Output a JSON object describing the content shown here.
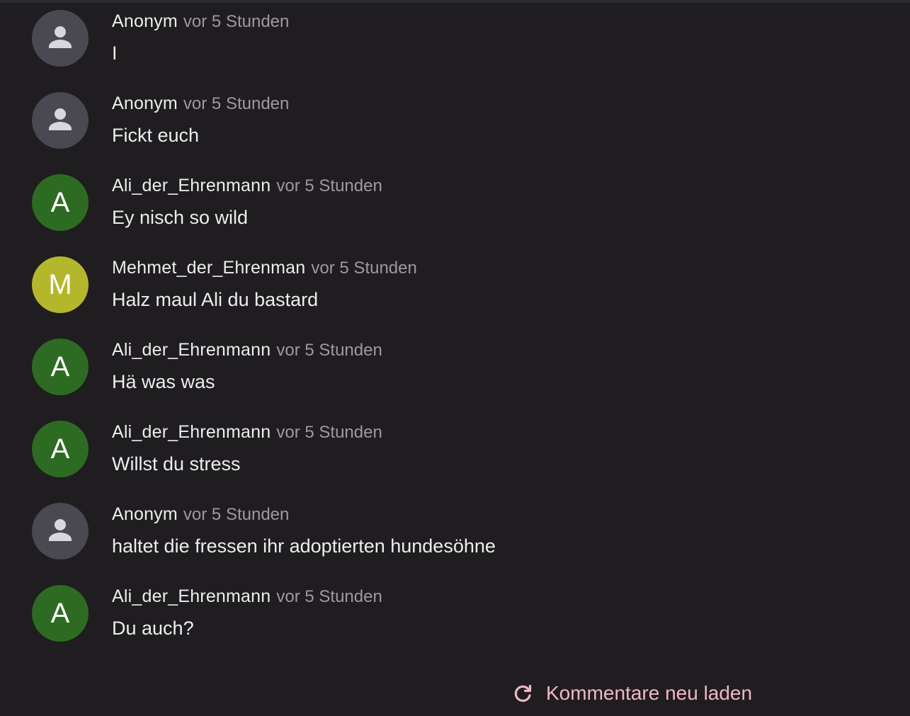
{
  "colors": {
    "background": "#1f1d20",
    "anonymous_avatar": "#4a4850",
    "green_avatar": "#2e6b22",
    "yellow_avatar": "#b4b72c",
    "accent": "#f2b6c8",
    "time_text": "#9c9aa0"
  },
  "comments": [
    {
      "author": "Anonym",
      "time": "vor 5 Stunden",
      "text": "I",
      "avatar_letter": "",
      "avatar_icon": "person-icon",
      "avatar_color": "#4a4850"
    },
    {
      "author": "Anonym",
      "time": "vor 5 Stunden",
      "text": "Fickt euch",
      "avatar_letter": "",
      "avatar_icon": "person-icon",
      "avatar_color": "#4a4850"
    },
    {
      "author": "Ali_der_Ehrenmann",
      "time": "vor 5 Stunden",
      "text": "Ey nisch so wild",
      "avatar_letter": "A",
      "avatar_icon": "",
      "avatar_color": "#2e6b22"
    },
    {
      "author": "Mehmet_der_Ehrenman",
      "time": "vor 5 Stunden",
      "text": "Halz maul Ali du bastard",
      "avatar_letter": "M",
      "avatar_icon": "",
      "avatar_color": "#b4b72c"
    },
    {
      "author": "Ali_der_Ehrenmann",
      "time": "vor 5 Stunden",
      "text": "Hä was was",
      "avatar_letter": "A",
      "avatar_icon": "",
      "avatar_color": "#2e6b22"
    },
    {
      "author": "Ali_der_Ehrenmann",
      "time": "vor 5 Stunden",
      "text": "Willst du stress",
      "avatar_letter": "A",
      "avatar_icon": "",
      "avatar_color": "#2e6b22"
    },
    {
      "author": "Anonym",
      "time": "vor 5 Stunden",
      "text": "haltet die fressen ihr adoptierten hundesöhne",
      "avatar_letter": "",
      "avatar_icon": "person-icon",
      "avatar_color": "#4a4850"
    },
    {
      "author": "Ali_der_Ehrenmann",
      "time": "vor 5 Stunden",
      "text": "Du auch?",
      "avatar_letter": "A",
      "avatar_icon": "",
      "avatar_color": "#2e6b22"
    }
  ],
  "reload": {
    "label": "Kommentare neu laden",
    "icon": "refresh-icon"
  }
}
